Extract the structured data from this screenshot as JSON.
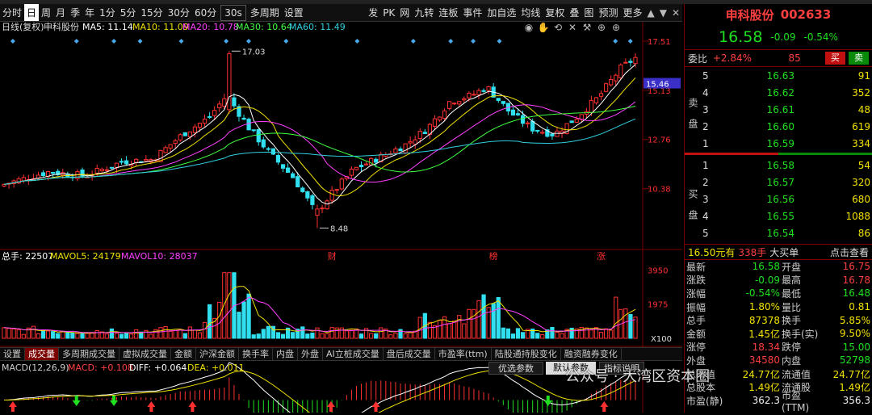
{
  "toolbar": {
    "left": [
      "分时",
      "日",
      "周",
      "月",
      "季",
      "年",
      "1分",
      "5分",
      "15分",
      "30分",
      "60分",
      "30s",
      "多周期",
      "设置"
    ],
    "selected": "日",
    "right": [
      "发",
      "PK",
      "网",
      "九转",
      "连板",
      "事件",
      "加自选",
      "均线",
      "复权",
      "叠",
      "图",
      "预测",
      "更多"
    ]
  },
  "ma_legend": {
    "prefix": "日线(复权)",
    "stock": "申科股份",
    "items": [
      {
        "label": "MA5: 11.14",
        "color": "#ffffff"
      },
      {
        "label": "MA10: 11.09",
        "color": "#f0e000"
      },
      {
        "label": "MA20: 10.78",
        "color": "#ff40ff"
      },
      {
        "label": "MA30: 10.64",
        "color": "#40ff40"
      },
      {
        "label": "MA60: 11.49",
        "color": "#30d0e0"
      }
    ]
  },
  "price_axis": {
    "ticks": [
      "17.51",
      "15.13",
      "12.76",
      "10.38"
    ],
    "current": "15.46"
  },
  "annotations": {
    "high": "17.03",
    "low": "8.48",
    "marks": [
      "财",
      "榜",
      "涨"
    ]
  },
  "volume_legend": {
    "items": [
      {
        "label": "总手: 22507",
        "color": "#ffffff"
      },
      {
        "label": "MAVOL5: 24179",
        "color": "#f0e000"
      },
      {
        "label": "MAVOL10: 28037",
        "color": "#ff40ff"
      }
    ],
    "axis": [
      "3950",
      "1975",
      "X100"
    ]
  },
  "tabs": [
    "设置",
    "成交量",
    "多周期成交量",
    "虚拟成交量",
    "金额",
    "沪深金额",
    "换手率",
    "内盘",
    "外盘",
    "AI立桩成交量",
    "盘后成交量",
    "市盈率(ttm)",
    "陆股通持股变化",
    "融资融券变化"
  ],
  "active_tab": "成交量",
  "macd_legend": {
    "items": [
      {
        "label": "MACD(12,26,9)",
        "color": "#cccccc"
      },
      {
        "label": "MACD: +0.108",
        "color": "#ff4040"
      },
      {
        "label": "DIFF: +0.064",
        "color": "#ffffff"
      },
      {
        "label": "DEA: +0.011",
        "color": "#f0e000"
      }
    ],
    "buttons": [
      "优选参数",
      "默认参数",
      "指标说明"
    ]
  },
  "quote": {
    "name": "申科股份",
    "code": "002633",
    "price": "16.58",
    "change": "-0.09",
    "change_pct": "-0.54%",
    "ratio_label": "委比",
    "ratio_value": "+2.84%",
    "ratio_diff": "85",
    "buy_btn": "买",
    "sell_btn": "卖",
    "sell_label": "卖盘",
    "buy_label": "买盘",
    "asks": [
      {
        "n": "5",
        "p": "16.63",
        "v": "91"
      },
      {
        "n": "4",
        "p": "16.62",
        "v": "352"
      },
      {
        "n": "3",
        "p": "16.61",
        "v": "48"
      },
      {
        "n": "2",
        "p": "16.60",
        "v": "619"
      },
      {
        "n": "1",
        "p": "16.59",
        "v": "334"
      }
    ],
    "bids": [
      {
        "n": "1",
        "p": "16.58",
        "v": "54"
      },
      {
        "n": "2",
        "p": "16.57",
        "v": "320"
      },
      {
        "n": "3",
        "p": "16.56",
        "v": "680"
      },
      {
        "n": "4",
        "p": "16.55",
        "v": "1088"
      },
      {
        "n": "5",
        "p": "16.54",
        "v": "86"
      }
    ],
    "big_order": {
      "price": "16.50元有",
      "qty": "338手",
      "label": "大买单",
      "link": "点击查看"
    },
    "stats": [
      {
        "k": "最新",
        "v": "16.58",
        "vc": "green",
        "k2": "开盘",
        "v2": "16.75",
        "v2c": "red"
      },
      {
        "k": "涨跌",
        "v": "-0.09",
        "vc": "green",
        "k2": "最高",
        "v2": "16.78",
        "v2c": "red"
      },
      {
        "k": "涨幅",
        "v": "-0.54%",
        "vc": "green",
        "k2": "最低",
        "v2": "16.48",
        "v2c": "green"
      },
      {
        "k": "振幅",
        "v": "1.80%",
        "vc": "yellow",
        "k2": "量比",
        "v2": "0.81",
        "v2c": "yellow"
      },
      {
        "k": "总手",
        "v": "87378",
        "vc": "yellow",
        "k2": "换手",
        "v2": "5.85%",
        "v2c": "yellow"
      },
      {
        "k": "金额",
        "v": "1.45亿",
        "vc": "yellow",
        "k2": "换手(实)",
        "v2": "9.50%",
        "v2c": "yellow"
      },
      {
        "k": "涨停",
        "v": "18.34",
        "vc": "red",
        "k2": "跌停",
        "v2": "15.00",
        "v2c": "green"
      },
      {
        "k": "外盘",
        "v": "34580",
        "vc": "red",
        "k2": "内盘",
        "v2": "52798",
        "v2c": "green"
      },
      {
        "k": "总市值",
        "v": "24.77亿",
        "vc": "yellow",
        "k2": "流通值",
        "v2": "24.77亿",
        "v2c": "yellow"
      },
      {
        "k": "总股本",
        "v": "1.49亿",
        "vc": "yellow",
        "k2": "流通股",
        "v2": "1.49亿",
        "v2c": "yellow"
      },
      {
        "k": "市盈(静)",
        "v": "362.3",
        "vc": "white",
        "k2": "市盈(TTM)",
        "v2": "356.3",
        "v2c": "white"
      }
    ]
  },
  "watermark": "公众号 · 大湾区资本圈",
  "colors": {
    "up": "#ff3030",
    "down": "#30e0f0",
    "ma5": "#ffffff",
    "ma10": "#f0e000",
    "ma20": "#ff40ff",
    "ma30": "#40ff40",
    "ma60": "#30d0e0"
  },
  "chart_data": {
    "type": "candlestick",
    "n": 130,
    "ylim": [
      7.6,
      17.9
    ],
    "anchors": [
      [
        0,
        10.6
      ],
      [
        12,
        11.2
      ],
      [
        22,
        11.0
      ],
      [
        32,
        11.7
      ],
      [
        40,
        11.8
      ],
      [
        48,
        13.0
      ],
      [
        55,
        13.8
      ],
      [
        60,
        14.9
      ],
      [
        66,
        13.3
      ],
      [
        72,
        12.0
      ],
      [
        78,
        10.9
      ],
      [
        84,
        9.2
      ],
      [
        88,
        10.1
      ],
      [
        94,
        11.3
      ],
      [
        100,
        11.8
      ],
      [
        108,
        12.5
      ],
      [
        114,
        13.3
      ],
      [
        120,
        14.6
      ],
      [
        126,
        14.9
      ],
      [
        130,
        15.3
      ],
      [
        136,
        14.1
      ],
      [
        142,
        13.3
      ],
      [
        148,
        13.0
      ],
      [
        154,
        13.8
      ],
      [
        160,
        14.8
      ],
      [
        166,
        16.2
      ],
      [
        170,
        16.7
      ]
    ],
    "volume_ylim": [
      0,
      4300
    ],
    "macd_ylim": [
      -0.6,
      0.6
    ]
  }
}
